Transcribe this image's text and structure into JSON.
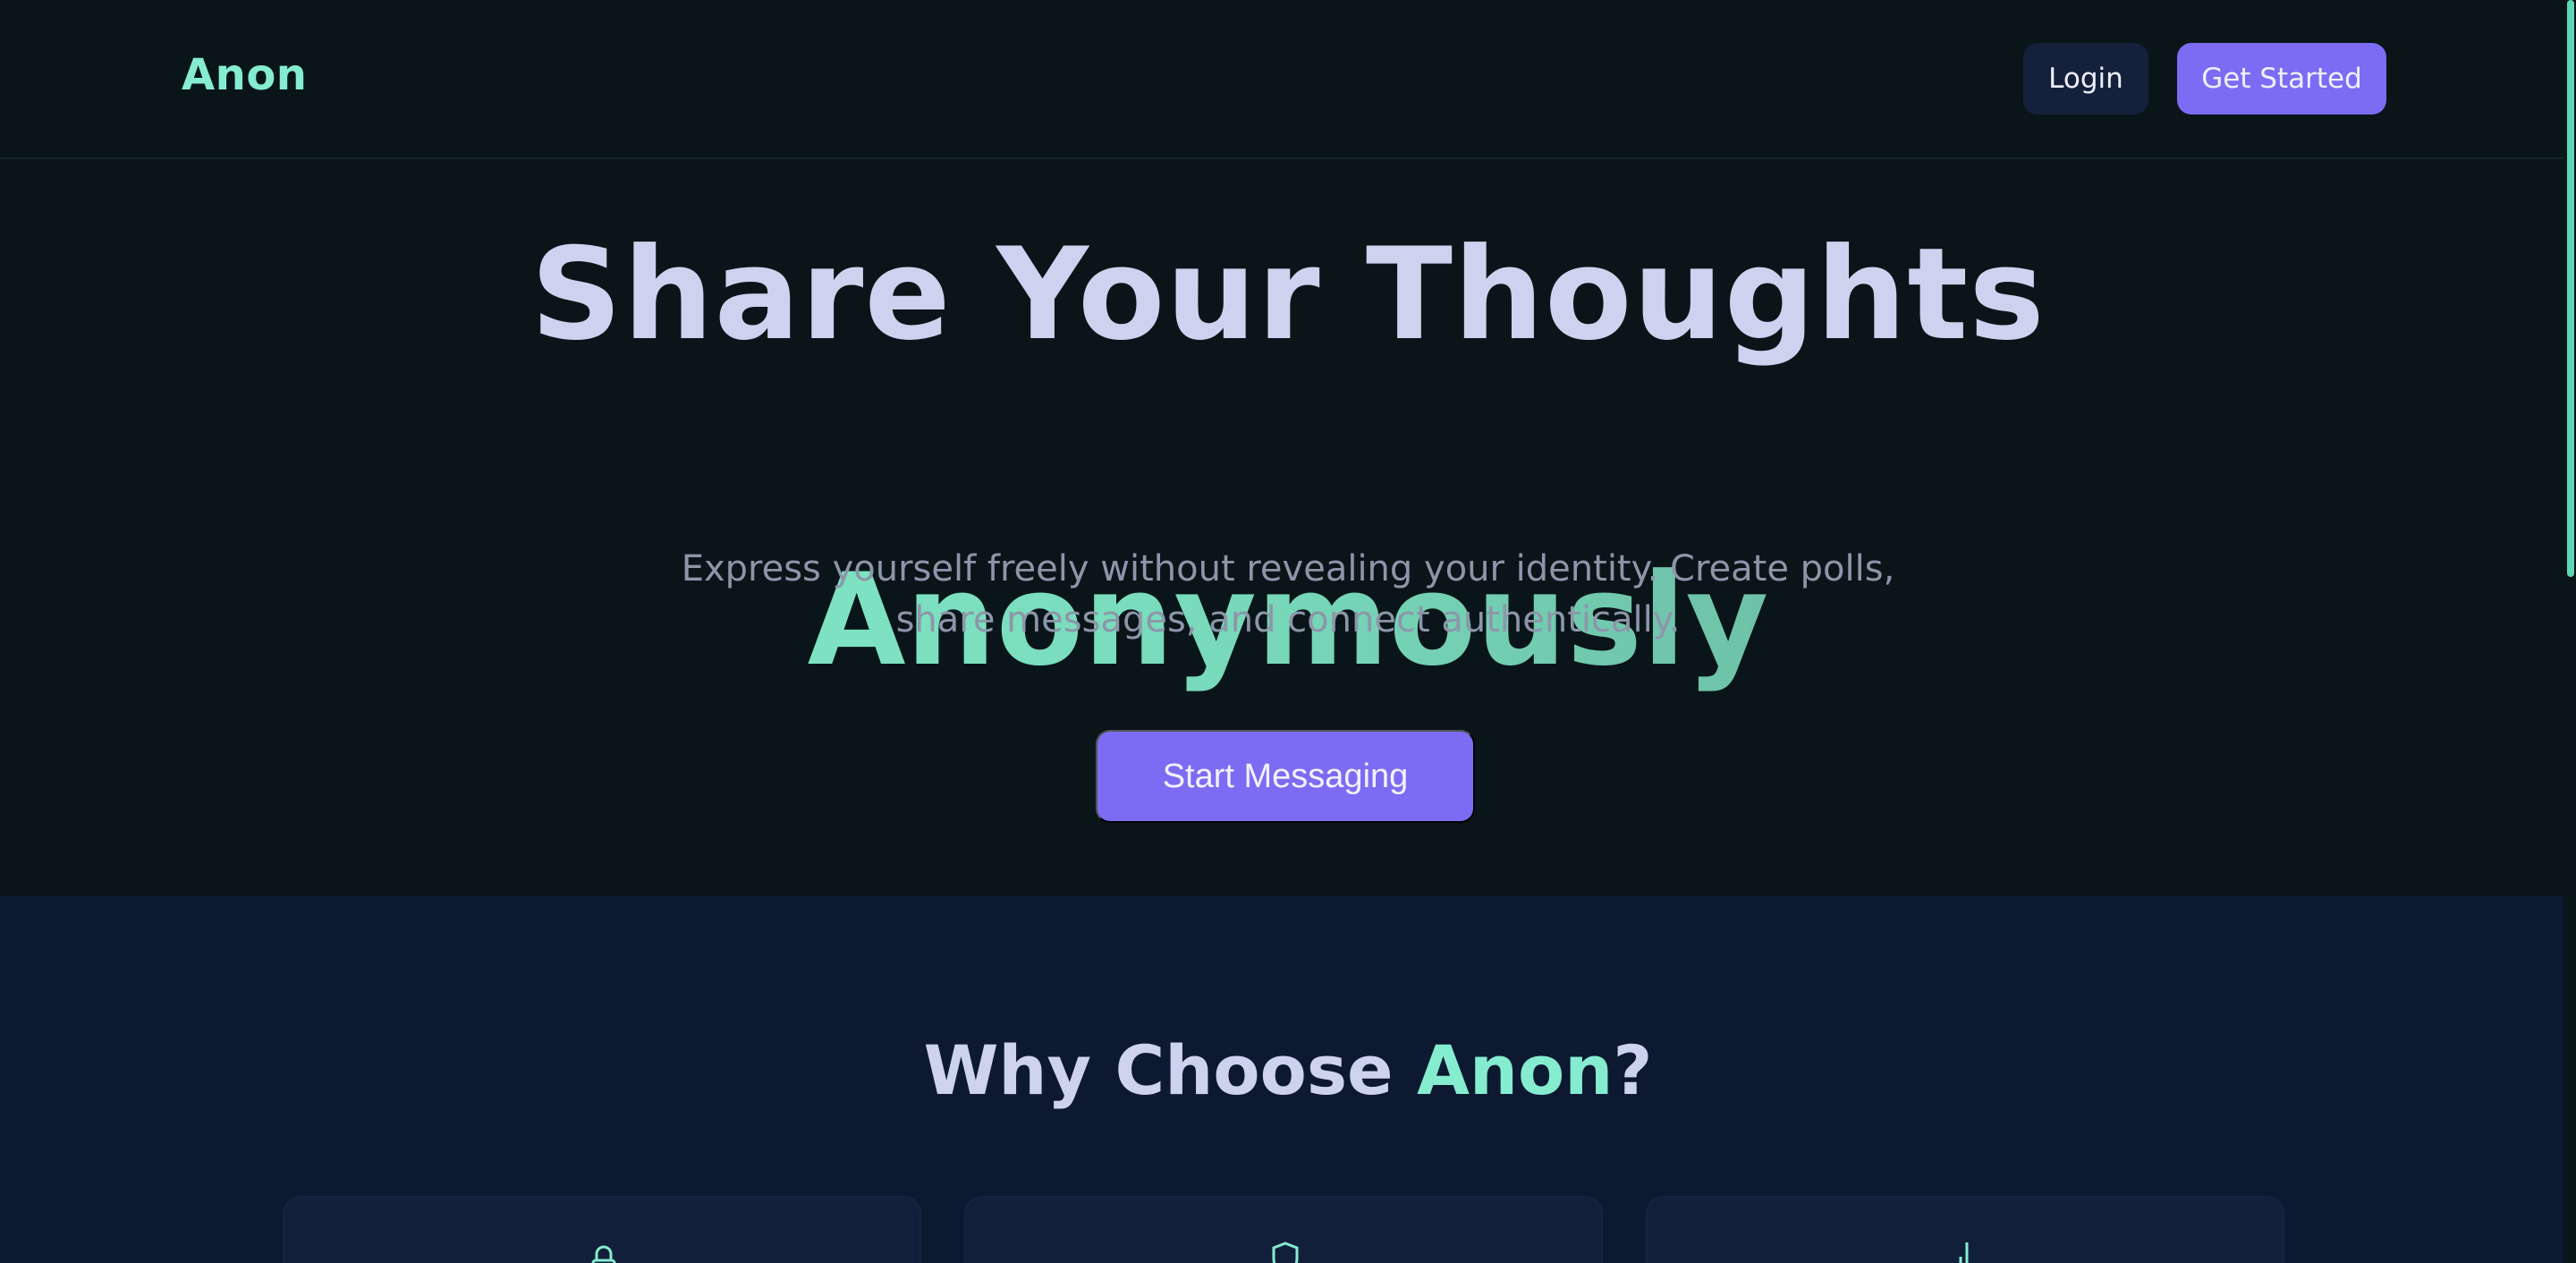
{
  "header": {
    "logo": "Anon",
    "login_label": "Login",
    "get_started_label": "Get Started"
  },
  "hero": {
    "title_line1": "Share Your Thoughts",
    "title_line2": "Anonymously",
    "subtitle_line1": "Express yourself freely without revealing your identity. Create polls,",
    "subtitle_line2": "share messages, and connect authentically.",
    "cta_label": "Start Messaging"
  },
  "features": {
    "title_prefix": "Why Choose ",
    "title_accent": "Anon",
    "title_suffix": "?",
    "cards": [
      {
        "icon": "lock-icon"
      },
      {
        "icon": "shield-icon"
      },
      {
        "icon": "chart-icon"
      }
    ]
  },
  "colors": {
    "background": "#0a1519",
    "accent": "#85ecd0",
    "primary_button": "#7c6cf3",
    "secondary_button": "#15213b",
    "features_bg": "#0d1930",
    "heading_text": "#cdd3ef",
    "muted_text": "#8d96a9"
  }
}
